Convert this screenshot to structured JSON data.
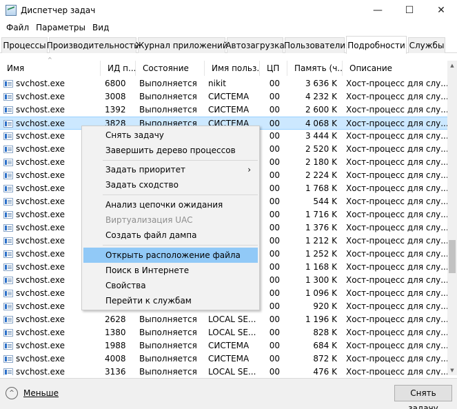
{
  "window": {
    "title": "Диспетчер задач",
    "controls": {
      "minimize": "—",
      "maximize": "☐",
      "close": "✕"
    }
  },
  "menu": [
    "Файл",
    "Параметры",
    "Вид"
  ],
  "tabs": [
    "Процессы",
    "Производительность",
    "Журнал приложений",
    "Автозагрузка",
    "Пользователи",
    "Подробности",
    "Службы"
  ],
  "active_tab": "Подробности",
  "columns": [
    "Имя",
    "ИД п...",
    "Состояние",
    "Имя польз...",
    "ЦП",
    "Память (ч...",
    "Описание"
  ],
  "rows": [
    {
      "name": "svchost.exe",
      "pid": "6800",
      "status": "Выполняется",
      "user": "nikit",
      "cpu": "00",
      "mem": "3 636 K",
      "desc": "Хост-процесс для слу..."
    },
    {
      "name": "svchost.exe",
      "pid": "3008",
      "status": "Выполняется",
      "user": "СИСТЕМА",
      "cpu": "00",
      "mem": "4 232 K",
      "desc": "Хост-процесс для слу..."
    },
    {
      "name": "svchost.exe",
      "pid": "1392",
      "status": "Выполняется",
      "user": "СИСТЕМА",
      "cpu": "00",
      "mem": "2 600 K",
      "desc": "Хост-процесс для слу..."
    },
    {
      "name": "svchost.exe",
      "pid": "3828",
      "status": "Выполняется",
      "user": "СИСТЕМА",
      "cpu": "00",
      "mem": "4 068 K",
      "desc": "Хост-процесс для слу..."
    },
    {
      "name": "svchost.exe",
      "pid": "",
      "status": "",
      "user": "",
      "cpu": "00",
      "mem": "3 444 K",
      "desc": "Хост-процесс для слу..."
    },
    {
      "name": "svchost.exe",
      "pid": "",
      "status": "",
      "user": "",
      "cpu": "00",
      "mem": "2 520 K",
      "desc": "Хост-процесс для слу..."
    },
    {
      "name": "svchost.exe",
      "pid": "",
      "status": "",
      "user": "",
      "cpu": "00",
      "mem": "2 180 K",
      "desc": "Хост-процесс для слу..."
    },
    {
      "name": "svchost.exe",
      "pid": "",
      "status": "",
      "user": "",
      "cpu": "00",
      "mem": "2 224 K",
      "desc": "Хост-процесс для слу..."
    },
    {
      "name": "svchost.exe",
      "pid": "",
      "status": "",
      "user": "",
      "cpu": "00",
      "mem": "1 768 K",
      "desc": "Хост-процесс для слу..."
    },
    {
      "name": "svchost.exe",
      "pid": "",
      "status": "",
      "user": "",
      "cpu": "00",
      "mem": "544 K",
      "desc": "Хост-процесс для слу..."
    },
    {
      "name": "svchost.exe",
      "pid": "",
      "status": "",
      "user": "",
      "cpu": "00",
      "mem": "1 716 K",
      "desc": "Хост-процесс для слу..."
    },
    {
      "name": "svchost.exe",
      "pid": "",
      "status": "",
      "user": "",
      "cpu": "00",
      "mem": "1 376 K",
      "desc": "Хост-процесс для слу..."
    },
    {
      "name": "svchost.exe",
      "pid": "",
      "status": "",
      "user": "",
      "cpu": "00",
      "mem": "1 212 K",
      "desc": "Хост-процесс для слу..."
    },
    {
      "name": "svchost.exe",
      "pid": "",
      "status": "",
      "user": "",
      "cpu": "00",
      "mem": "1 252 K",
      "desc": "Хост-процесс для слу..."
    },
    {
      "name": "svchost.exe",
      "pid": "",
      "status": "",
      "user": "",
      "cpu": "00",
      "mem": "1 168 K",
      "desc": "Хост-процесс для слу..."
    },
    {
      "name": "svchost.exe",
      "pid": "",
      "status": "",
      "user": "",
      "cpu": "00",
      "mem": "1 300 K",
      "desc": "Хост-процесс для слу..."
    },
    {
      "name": "svchost.exe",
      "pid": "",
      "status": "",
      "user": "",
      "cpu": "00",
      "mem": "1 096 K",
      "desc": "Хост-процесс для слу..."
    },
    {
      "name": "svchost.exe",
      "pid": "",
      "status": "",
      "user": "",
      "cpu": "00",
      "mem": "920 K",
      "desc": "Хост-процесс для слу..."
    },
    {
      "name": "svchost.exe",
      "pid": "2628",
      "status": "Выполняется",
      "user": "LOCAL SE...",
      "cpu": "00",
      "mem": "1 196 K",
      "desc": "Хост-процесс для слу..."
    },
    {
      "name": "svchost.exe",
      "pid": "1380",
      "status": "Выполняется",
      "user": "LOCAL SE...",
      "cpu": "00",
      "mem": "828 K",
      "desc": "Хост-процесс для слу..."
    },
    {
      "name": "svchost.exe",
      "pid": "1988",
      "status": "Выполняется",
      "user": "СИСТЕМА",
      "cpu": "00",
      "mem": "684 K",
      "desc": "Хост-процесс для слу..."
    },
    {
      "name": "svchost.exe",
      "pid": "4008",
      "status": "Выполняется",
      "user": "СИСТЕМА",
      "cpu": "00",
      "mem": "872 K",
      "desc": "Хост-процесс для слу..."
    },
    {
      "name": "svchost.exe",
      "pid": "3136",
      "status": "Выполняется",
      "user": "LOCAL SE...",
      "cpu": "00",
      "mem": "476 K",
      "desc": "Хост-процесс для слу..."
    }
  ],
  "selected_row": 3,
  "context_menu": {
    "end_task": "Снять задачу",
    "end_tree": "Завершить дерево процессов",
    "set_priority": "Задать приоритет",
    "set_affinity": "Задать сходство",
    "analyze_wait": "Анализ цепочки ожидания",
    "uac_virtualization": "Виртуализация UAC",
    "create_dump": "Создать файл дампа",
    "open_location": "Открыть расположение файла",
    "search_online": "Поиск в Интернете",
    "properties": "Свойства",
    "go_to_services": "Перейти к службам",
    "submenu_arrow": "›"
  },
  "footer": {
    "fewer_details": "Меньше",
    "end_task_button": "Снять задачу"
  },
  "icons": {
    "sort_arrow": "^",
    "collapse": "^",
    "scroll_up": "▲",
    "scroll_down": "▼"
  }
}
